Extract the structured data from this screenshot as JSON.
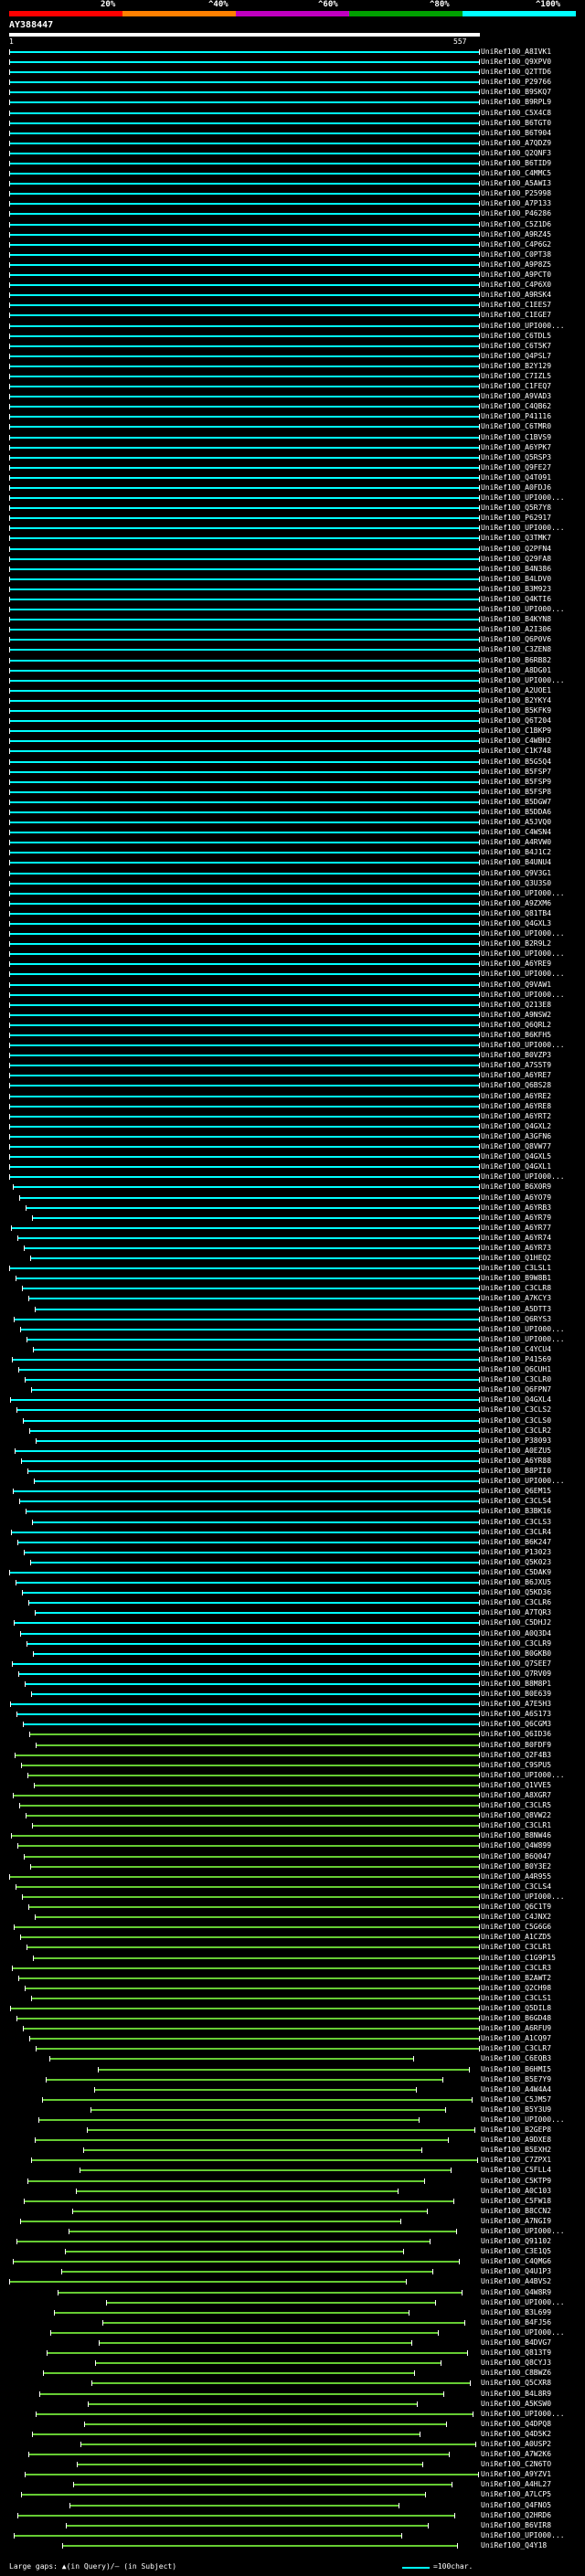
{
  "header": {
    "scale_labels": [
      "20%",
      "^40%",
      "^60%",
      "^80%",
      "^100%"
    ],
    "scale_colors": [
      "#ff0000",
      "#ff8000",
      "#c000c0",
      "#00a000",
      "#00ffff"
    ],
    "query_name": "AY388447",
    "query_start": "1",
    "query_end": "557"
  },
  "colors": {
    "cyan": "#00ffff",
    "green": "#66cc33",
    "white": "#ffffff"
  },
  "hits": [
    "UniRef100_A8IVK1",
    "UniRef100_Q9XPV0",
    "UniRef100_Q2TTD6",
    "UniRef100_P29766",
    "UniRef100_B9SKQ7",
    "UniRef100_B9RPL9",
    "UniRef100_C5X4C8",
    "UniRef100_B6TGT0",
    "UniRef100_B6T904",
    "UniRef100_A7QDZ9",
    "UniRef100_Q2QNF3",
    "UniRef100_B6TID9",
    "UniRef100_C4MMC5",
    "UniRef100_A5AWI3",
    "UniRef100_P25998",
    "UniRef100_A7P133",
    "UniRef100_P46286",
    "UniRef100_C5Z1D6",
    "UniRef100_A9RZ45",
    "UniRef100_C4P6G2",
    "UniRef100_C0PT38",
    "UniRef100_A9P8Z5",
    "UniRef100_A9PCT0",
    "UniRef100_C4P6X0",
    "UniRef100_A9RSK4",
    "UniRef100_C1EES7",
    "UniRef100_C1EGE7",
    "UniRef100_UPI000...",
    "UniRef100_C6TDL5",
    "UniRef100_C6T5K7",
    "UniRef100_Q4PSL7",
    "UniRef100_B2Y129",
    "UniRef100_C7IZL5",
    "UniRef100_C1FEQ7",
    "UniRef100_A9VAD3",
    "UniRef100_C4QB62",
    "UniRef100_P41116",
    "UniRef100_C6TMR0",
    "UniRef100_C1BVS9",
    "UniRef100_A6YPK7",
    "UniRef100_Q5RSP3",
    "UniRef100_Q9FE27",
    "UniRef100_Q4T091",
    "UniRef100_A0FDJ6",
    "UniRef100_UPI000...",
    "UniRef100_Q5R7Y8",
    "UniRef100_P62917",
    "UniRef100_UPI000...",
    "UniRef100_Q3TMK7",
    "UniRef100_Q2PFN4",
    "UniRef100_Q29FA8",
    "UniRef100_B4N386",
    "UniRef100_B4LDV0",
    "UniRef100_B3M923",
    "UniRef100_Q4KTI6",
    "UniRef100_UPI000...",
    "UniRef100_B4KYN8",
    "UniRef100_A2I306",
    "UniRef100_Q6P0V6",
    "UniRef100_C3ZEN8",
    "UniRef100_B6RB82",
    "UniRef100_A8DG01",
    "UniRef100_UPI000...",
    "UniRef100_A2UOE1",
    "UniRef100_B2YKY4",
    "UniRef100_B5KFK9",
    "UniRef100_Q6T204",
    "UniRef100_C1BKP9",
    "UniRef100_C4WBH2",
    "UniRef100_C1K748",
    "UniRef100_B5G5Q4",
    "UniRef100_B5FSP7",
    "UniRef100_B5FSP9",
    "UniRef100_B5FSP8",
    "UniRef100_B5DGW7",
    "UniRef100_B5DDA6",
    "UniRef100_A5JVQ0",
    "UniRef100_C4WSN4",
    "UniRef100_A4RVW0",
    "UniRef100_B4J1C2",
    "UniRef100_B4UNU4",
    "UniRef100_Q9V3G1",
    "UniRef100_Q3U3S0",
    "UniRef100_UPI000...",
    "UniRef100_A9ZXM6",
    "UniRef100_Q81TB4",
    "UniRef100_Q4GXL3",
    "UniRef100_UPI000...",
    "UniRef100_B2R9L2",
    "UniRef100_UPI000...",
    "UniRef100_A6YRE9",
    "UniRef100_UPI000...",
    "UniRef100_Q9VAW1",
    "UniRef100_UPI000...",
    "UniRef100_Q213E8",
    "UniRef100_A9NSW2",
    "UniRef100_Q6QRL2",
    "UniRef100_B6KFH5",
    "UniRef100_UPI000...",
    "UniRef100_B0VZP3",
    "UniRef100_A7S5T9",
    "UniRef100_A6YRE7",
    "UniRef100_Q6BS28",
    "UniRef100_A6YRE2",
    "UniRef100_A6YRE8",
    "UniRef100_A6YRT2",
    "UniRef100_Q4GXL2",
    "UniRef100_A3GFN6",
    "UniRef100_Q8VW77",
    "UniRef100_Q4GXL5",
    "UniRef100_Q4GXL1",
    "UniRef100_UPI000...",
    "UniRef100_B6X0R9",
    "UniRef100_A6YO79",
    "UniRef100_A6YRB3",
    "UniRef100_A6YR79",
    "UniRef100_A6YR77",
    "UniRef100_A6YR74",
    "UniRef100_A6YR73",
    "UniRef100_Q1HEQ2",
    "UniRef100_C3LSL1",
    "UniRef100_B9W8B1",
    "UniRef100_C3CLR8",
    "UniRef100_A7KCY3",
    "UniRef100_A5DTT3",
    "UniRef100_Q6RYS3",
    "UniRef100_UPI000...",
    "UniRef100_UPI000...",
    "UniRef100_C4YCU4",
    "UniRef100_P41569",
    "UniRef100_Q6CUH1",
    "UniRef100_C3CLR0",
    "UniRef100_Q6FPN7",
    "UniRef100_Q4GXL4",
    "UniRef100_C3CLS2",
    "UniRef100_C3CLS0",
    "UniRef100_C3CLR2",
    "UniRef100_P38093",
    "UniRef100_A0EZU5",
    "UniRef100_A6YR88",
    "UniRef100_B8PII0",
    "UniRef100_UPI000...",
    "UniRef100_Q6EM15",
    "UniRef100_C3CLS4",
    "UniRef100_B3BK16",
    "UniRef100_C3CLS3",
    "UniRef100_C3CLR4",
    "UniRef100_B6K247",
    "UniRef100_P13023",
    "UniRef100_Q5K023",
    "UniRef100_C5DAK9",
    "UniRef100_B6JXU5",
    "UniRef100_Q5KD36",
    "UniRef100_C3CLR6",
    "UniRef100_A7TQR3",
    "UniRef100_C5DHJ2",
    "UniRef100_A0Q3D4",
    "UniRef100_C3CLR9",
    "UniRef100_B0GKB0",
    "UniRef100_Q7SEE7",
    "UniRef100_Q7RV09",
    "UniRef100_B8M8P1",
    "UniRef100_B0E639",
    "UniRef100_A7E5H3",
    "UniRef100_A6S173",
    "UniRef100_Q6CGM3",
    "UniRef100_Q6ID36",
    "UniRef100_B0FDF9",
    "UniRef100_Q2F4B3",
    "UniRef100_C9SPU5",
    "UniRef100_UPI000...",
    "UniRef100_Q1VVE5",
    "UniRef100_A8XGR7",
    "UniRef100_C3CLR5",
    "UniRef100_Q8VW22",
    "UniRef100_C3CLR1",
    "UniRef100_B8NW46",
    "UniRef100_Q4W899",
    "UniRef100_B6Q047",
    "UniRef100_B0Y3E2",
    "UniRef100_A4R955",
    "UniRef100_C3CLS4",
    "UniRef100_UPI000...",
    "UniRef100_Q6C1T9",
    "UniRef100_C4JNX2",
    "UniRef100_C5G6G6",
    "UniRef100_A1CZD5",
    "UniRef100_C3CLR1",
    "UniRef100_C1G9P15",
    "UniRef100_C3CLR3",
    "UniRef100_B2AWT2",
    "UniRef100_Q2CH98",
    "UniRef100_C3CLS1",
    "UniRef100_Q5DIL8",
    "UniRef100_B6GD48",
    "UniRef100_A6RFU9",
    "UniRef100_A1CQ97",
    "UniRef100_C3CLR7",
    "UniRef100_C6EQB3",
    "UniRef100_B6HMI5",
    "UniRef100_B5E7Y9",
    "UniRef100_A4W4A4",
    "UniRef100_C5JM57",
    "UniRef100_B5Y3U9",
    "UniRef100_UPI000...",
    "UniRef100_B2GEP8",
    "UniRef100_A9DXE8",
    "UniRef100_B5EXH2",
    "UniRef100_C7ZPX1",
    "UniRef100_C5FLL4",
    "UniRef100_C5KTP9",
    "UniRef100_A0C103",
    "UniRef100_C5FW18",
    "UniRef100_B8CCN2",
    "UniRef100_A7NGI9",
    "UniRef100_UPI000...",
    "UniRef100_Q91102",
    "UniRef100_C3E1Q5",
    "UniRef100_C4QMG6",
    "UniRef100_Q4U1P3",
    "UniRef100_A4BVS2",
    "UniRef100_Q4W8R9",
    "UniRef100_UPI000...",
    "UniRef100_B3L699",
    "UniRef100_B4FJ56",
    "UniRef100_UPI000...",
    "UniRef100_B4DVG7",
    "UniRef100_Q813T9",
    "UniRef100_Q8CYJ3",
    "UniRef100_C8BWZ6",
    "UniRef100_Q5CXR8",
    "UniRef100_B4L8R9",
    "UniRef100_A5KSW0",
    "UniRef100_UPI000...",
    "UniRef100_Q4DPQ8",
    "UniRef100_Q4D5K2",
    "UniRef100_A0USP2",
    "UniRef100_A7W2K6",
    "UniRef100_C2N6TO",
    "UniRef100_A9YZV1",
    "UniRef100_A4HL27",
    "UniRef100_A7LCP5",
    "UniRef100_Q4FNO5",
    "UniRef100_Q2HRD6",
    "UniRef100_B6VIR8",
    "UniRef100_UPI000...",
    "UniRef100_Q4Y18"
  ]
}
